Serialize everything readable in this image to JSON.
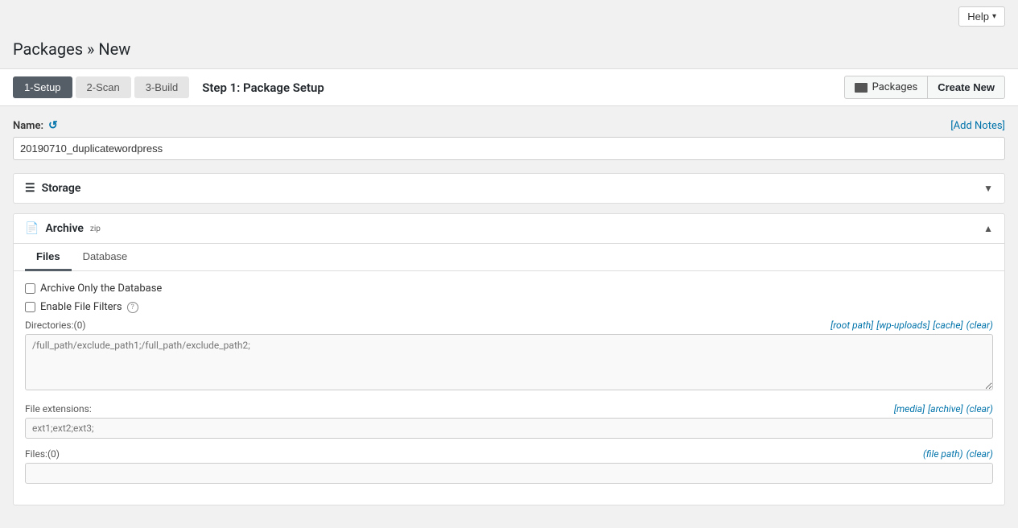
{
  "topbar": {
    "help_label": "Help",
    "chevron": "▾"
  },
  "page": {
    "title": "Packages » New"
  },
  "steps": {
    "step1_label": "1-Setup",
    "step2_label": "2-Scan",
    "step3_label": "3-Build",
    "current_step_text": "Step 1: Package Setup"
  },
  "header_actions": {
    "packages_label": "Packages",
    "create_new_label": "Create New"
  },
  "name_section": {
    "label": "Name:",
    "add_notes_label": "[Add Notes]",
    "value": "20190710_duplicatewordpress"
  },
  "storage": {
    "title": "Storage",
    "icon": "☰"
  },
  "archive": {
    "title": "Archive",
    "zip_label": "zip",
    "tabs": [
      {
        "id": "files",
        "label": "Files",
        "active": true
      },
      {
        "id": "database",
        "label": "Database",
        "active": false
      }
    ],
    "checkbox_archive_only": "Archive Only the Database",
    "checkbox_enable_filters": "Enable File Filters",
    "directories_label": "Directories:",
    "directories_count": "(0)",
    "directories_links": [
      {
        "label": "[root path]"
      },
      {
        "label": "[wp-uploads]"
      },
      {
        "label": "[cache]"
      },
      {
        "label": "(clear)"
      }
    ],
    "directories_placeholder": "/full_path/exclude_path1;/full_path/exclude_path2;",
    "file_extensions_label": "File extensions:",
    "file_extensions_links": [
      {
        "label": "[media]"
      },
      {
        "label": "[archive]"
      },
      {
        "label": "(clear)"
      }
    ],
    "file_extensions_placeholder": "ext1;ext2;ext3;",
    "files_label": "Files:",
    "files_count": "(0)",
    "files_links": [
      {
        "label": "(file path)"
      },
      {
        "label": "(clear)"
      }
    ]
  }
}
